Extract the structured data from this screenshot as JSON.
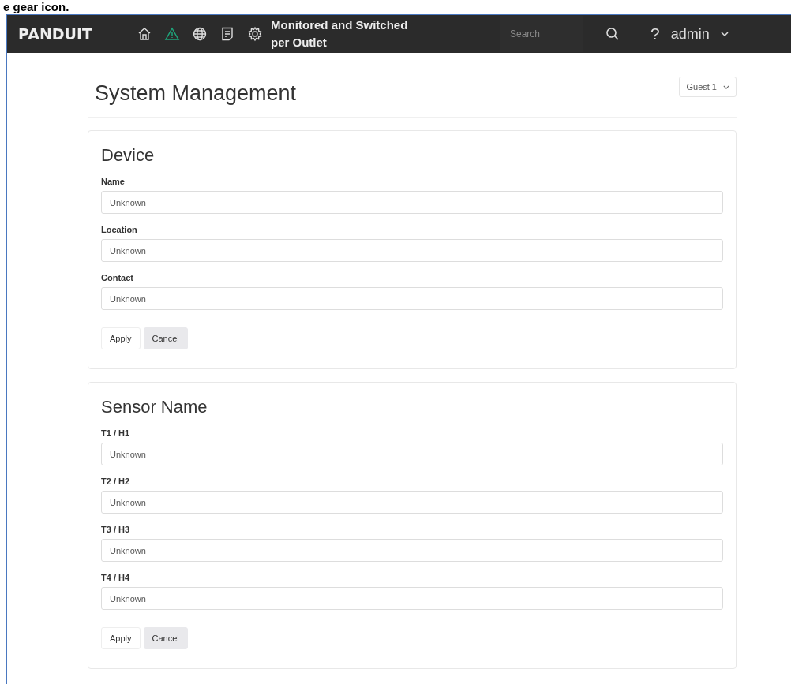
{
  "caption": "e gear icon.",
  "navbar": {
    "logo": "PANDUIT",
    "icons": [
      {
        "kind": "home"
      },
      {
        "kind": "alert"
      },
      {
        "kind": "globe"
      },
      {
        "kind": "log"
      },
      {
        "kind": "settings"
      }
    ],
    "title": "Monitored and Switched per Outlet",
    "search": {
      "placeholder": "Search"
    },
    "help": "?",
    "user": "admin"
  },
  "page": {
    "title": "System Management",
    "user_select": "Guest 1"
  },
  "sections": [
    {
      "title": "Device",
      "fields": [
        {
          "label": "Name",
          "value": "Unknown"
        },
        {
          "label": "Location",
          "value": "Unknown"
        },
        {
          "label": "Contact",
          "value": "Unknown"
        }
      ],
      "buttons": [
        "Apply",
        "Cancel"
      ]
    },
    {
      "title": "Sensor Name",
      "fields": [
        {
          "label": "T1 / H1",
          "value": "Unknown"
        },
        {
          "label": "T2 / H2",
          "value": "Unknown"
        },
        {
          "label": "T3 / H3",
          "value": "Unknown"
        },
        {
          "label": "T4 / H4",
          "value": "Unknown"
        }
      ],
      "buttons": [
        "Apply",
        "Cancel"
      ]
    }
  ]
}
